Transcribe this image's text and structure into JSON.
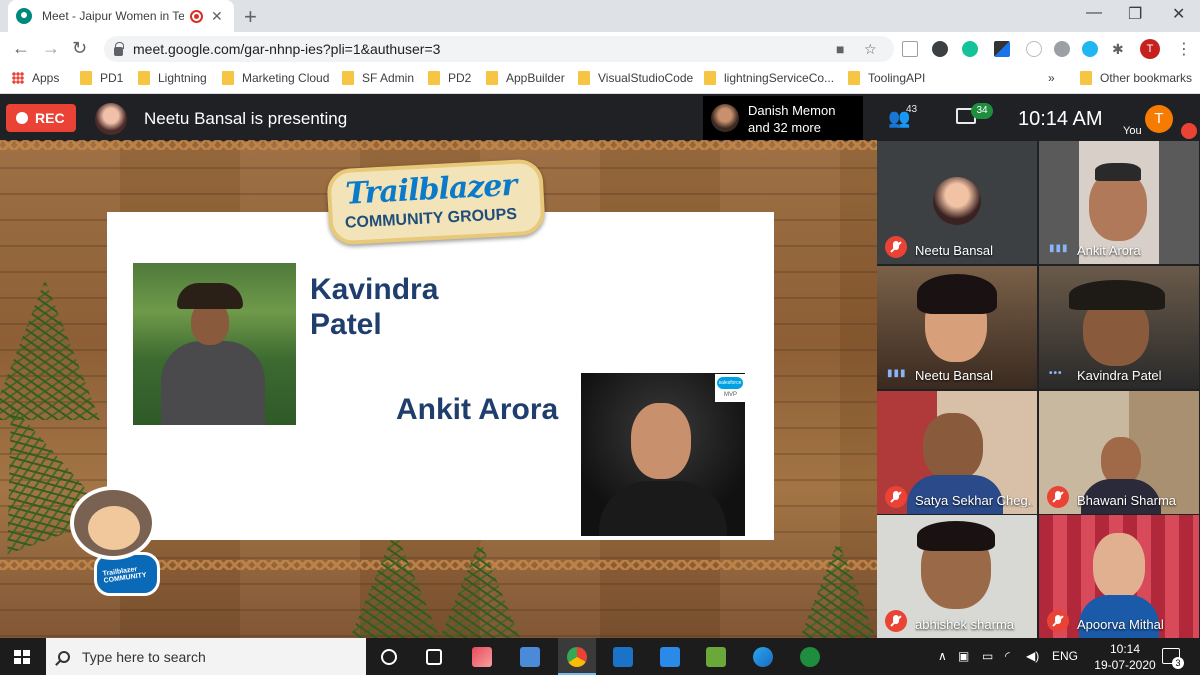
{
  "browser": {
    "tab_title": "Meet - Jaipur Women in Tech",
    "url": "meet.google.com/gar-nhnp-ies?pli=1&authuser=3",
    "profile_initial": "T",
    "bookmarks": [
      "Apps",
      "PD1",
      "Lightning",
      "Marketing Cloud",
      "SF Admin",
      "PD2",
      "AppBuilder",
      "VisualStudioCode",
      "lightningServiceCo...",
      "ToolingAPI"
    ],
    "more_bookmarks": "»",
    "other_bookmarks": "Other bookmarks"
  },
  "meet": {
    "rec_label": "REC",
    "presenting_text": "Neetu Bansal is presenting",
    "guests_line1": "Danish Memon",
    "guests_line2": "and 32 more",
    "participant_count": "43",
    "chat_count": "34",
    "time": "10:14 AM",
    "you_initial": "T",
    "you_label": "You",
    "colors": {
      "rec": "#ea4335",
      "chat_badge": "#1e8e3e",
      "you_avatar": "#f57c00"
    }
  },
  "slide": {
    "logo_line1": "Trailblazer",
    "logo_line2": "COMMUNITY GROUPS",
    "name_first_line1": "Kavindra",
    "name_first_line2": "Patel",
    "name_second": "Ankit Arora",
    "badge_brand": "salesforce",
    "badge_text": "MVP",
    "mascot_shirt": "Trailblazer COMMUNITY",
    "colors": {
      "name": "#1f3e6e",
      "logo_blue": "#0a7ac9"
    }
  },
  "participants": [
    {
      "name": "Neetu Bansal",
      "state": "muted"
    },
    {
      "name": "Ankit Arora",
      "state": "speaking"
    },
    {
      "name": "Neetu Bansal",
      "state": "speaking"
    },
    {
      "name": "Kavindra Patel",
      "state": "speaking"
    },
    {
      "name": "Satya Sekhar Cheg...",
      "state": "muted"
    },
    {
      "name": "Bhawani Sharma",
      "state": "muted"
    },
    {
      "name": "abhishek sharma",
      "state": "muted"
    },
    {
      "name": "Apoorva Mithal",
      "state": "muted"
    }
  ],
  "taskbar": {
    "search_placeholder": "Type here to search",
    "language": "ENG",
    "clock_time": "10:14",
    "clock_date": "19-07-2020",
    "notification_count": "3"
  }
}
